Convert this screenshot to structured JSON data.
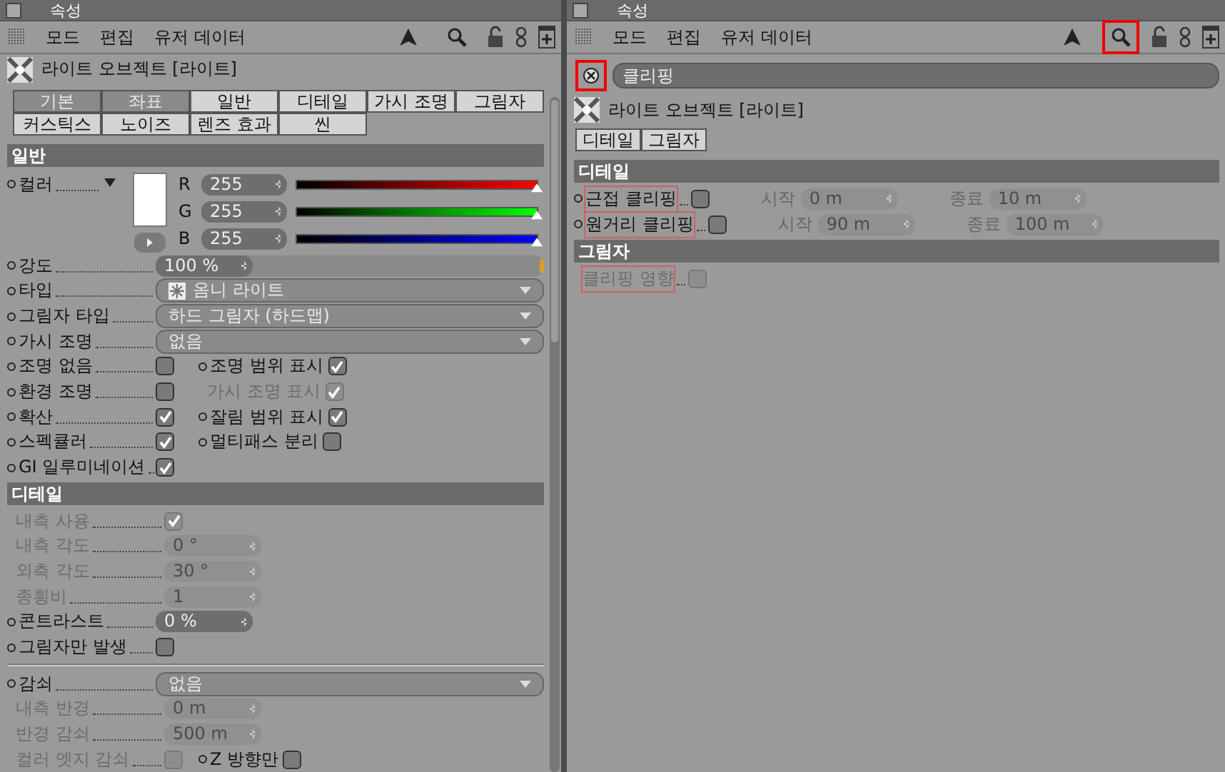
{
  "panels": [
    {
      "title": "속성",
      "menu": [
        "모드",
        "편집",
        "유저 데이터"
      ],
      "search_highlighted": false,
      "object_title": "라이트 오브젝트 [라이트]",
      "tabs": [
        {
          "label": "기본",
          "selected": false
        },
        {
          "label": "좌표",
          "selected": false
        },
        {
          "label": "일반",
          "selected": true
        },
        {
          "label": "디테일",
          "selected": true
        },
        {
          "label": "가시 조명",
          "selected": true
        },
        {
          "label": "그림자",
          "selected": true
        },
        {
          "label": "커스틱스",
          "selected": true
        },
        {
          "label": "노이즈",
          "selected": true
        },
        {
          "label": "렌즈 효과",
          "selected": true
        },
        {
          "label": "씬",
          "selected": true
        }
      ],
      "sections": [
        {
          "title": "일반",
          "rows": [
            {
              "kind": "color",
              "label": "컬러",
              "channels": [
                {
                  "name": "R",
                  "value": "255",
                  "level": 1,
                  "color": "#ff0000"
                },
                {
                  "name": "G",
                  "value": "255",
                  "level": 1,
                  "color": "#00ff00"
                },
                {
                  "name": "B",
                  "value": "255",
                  "level": 1,
                  "color": "#0000ff"
                }
              ]
            },
            {
              "kind": "slider",
              "label": "강도",
              "value": "100 %",
              "level": 1
            },
            {
              "kind": "dropdown",
              "label": "타입",
              "value": "옴니 라이트",
              "value_icon": true
            },
            {
              "kind": "dropdown",
              "label": "그림자 타입",
              "value": "하드 그림자 (하드맵)",
              "value_icon": false
            },
            {
              "kind": "dropdown",
              "label": "가시 조명",
              "value": "없음",
              "value_icon": false
            },
            {
              "kind": "checks",
              "items": [
                {
                  "label": "조명 없음",
                  "checked": false,
                  "disabled": false
                },
                {
                  "label": "조명 범위 표시",
                  "checked": true,
                  "disabled": false
                }
              ]
            },
            {
              "kind": "checks",
              "items": [
                {
                  "label": "환경 조명",
                  "checked": false,
                  "disabled": false
                },
                {
                  "label": "가시 조명 표시",
                  "checked": true,
                  "disabled": true
                }
              ]
            },
            {
              "kind": "checks",
              "items": [
                {
                  "label": "확산",
                  "checked": true,
                  "disabled": false
                },
                {
                  "label": "잘림 범위 표시",
                  "checked": true,
                  "disabled": false
                }
              ]
            },
            {
              "kind": "checks",
              "items": [
                {
                  "label": "스펙큘러",
                  "checked": true,
                  "disabled": false
                },
                {
                  "label": "멀티패스 분리",
                  "checked": false,
                  "disabled": false
                }
              ]
            },
            {
              "kind": "checks",
              "items": [
                {
                  "label": "GI 일루미네이션",
                  "checked": true,
                  "disabled": false
                }
              ]
            }
          ]
        },
        {
          "title": "디테일",
          "rows": [
            {
              "kind": "checks",
              "items": [
                {
                  "label": "내측 사용",
                  "checked": true,
                  "disabled": true
                }
              ]
            },
            {
              "kind": "number",
              "label": "내측 각도",
              "value": "0 °",
              "disabled": true
            },
            {
              "kind": "number",
              "label": "외측 각도",
              "value": "30 °",
              "disabled": true
            },
            {
              "kind": "number",
              "label": "종횡비",
              "value": "1",
              "disabled": true
            },
            {
              "kind": "number",
              "label": "콘트라스트",
              "value": "0 %",
              "disabled": false
            },
            {
              "kind": "checks",
              "items": [
                {
                  "label": "그림자만 발생",
                  "checked": false,
                  "disabled": false
                }
              ]
            },
            {
              "kind": "divider"
            },
            {
              "kind": "dropdown",
              "label": "감쇠",
              "value": "없음",
              "value_icon": false
            },
            {
              "kind": "number",
              "label": "내측 반경",
              "value": "0 m",
              "disabled": true
            },
            {
              "kind": "number",
              "label": "반경 감쇠",
              "value": "500 m",
              "disabled": true
            },
            {
              "kind": "checks",
              "items": [
                {
                  "label": "컬러 엣지 감쇠",
                  "checked": false,
                  "disabled": true
                },
                {
                  "label": "Z 방향만",
                  "checked": false,
                  "disabled": false
                }
              ]
            }
          ]
        }
      ]
    },
    {
      "title": "속성",
      "menu": [
        "모드",
        "편집",
        "유저 데이터"
      ],
      "search_highlighted": true,
      "search": {
        "value": "클리핑",
        "highlighted": true
      },
      "object_title": "라이트 오브젝트 [라이트]",
      "tabs": [
        {
          "label": "디테일",
          "selected": true
        },
        {
          "label": "그림자",
          "selected": true
        }
      ],
      "sections": [
        {
          "title": "디테일",
          "rows": [
            {
              "kind": "clip",
              "label": "근접 클리핑",
              "checked": false,
              "disabled": false,
              "highlighted": true,
              "fields": [
                {
                  "label": "시작",
                  "value": "0 m"
                },
                {
                  "label": "종료",
                  "value": "10 m"
                }
              ]
            },
            {
              "kind": "clip",
              "label": "원거리 클리핑",
              "checked": false,
              "disabled": false,
              "highlighted": true,
              "fields": [
                {
                  "label": "시작",
                  "value": "90 m"
                },
                {
                  "label": "종료",
                  "value": "100 m"
                }
              ]
            }
          ]
        },
        {
          "title": "그림자",
          "rows": [
            {
              "kind": "clip",
              "label": "클리핑 영향",
              "checked": false,
              "disabled": true,
              "highlighted": true,
              "fields": []
            }
          ]
        }
      ]
    }
  ]
}
